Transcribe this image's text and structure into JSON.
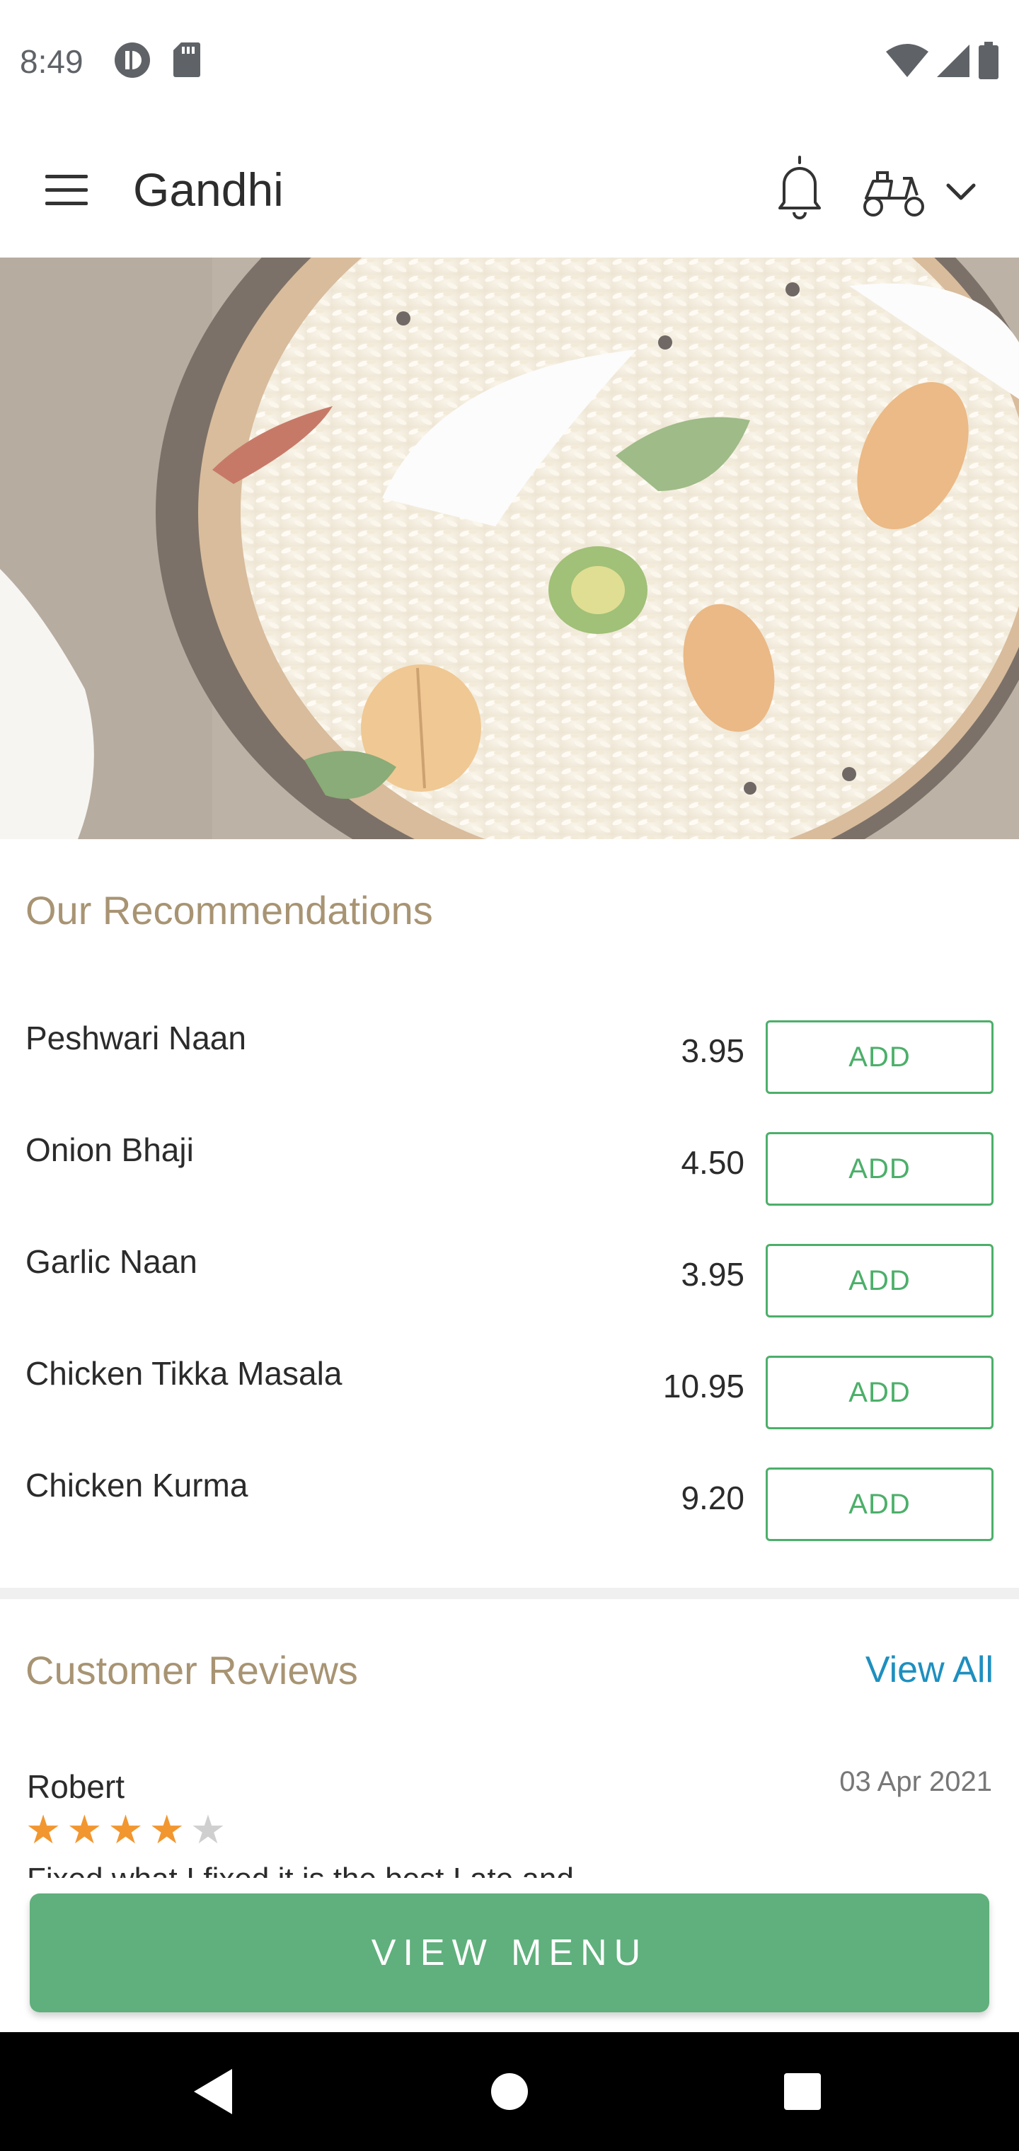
{
  "status_bar": {
    "time": "8:49",
    "icons": [
      "data-saver-icon",
      "sd-card-icon",
      "wifi-icon",
      "signal-icon",
      "battery-icon"
    ]
  },
  "app_bar": {
    "title": "Gandhi",
    "icons": [
      "menu-icon",
      "bell-icon",
      "delivery-scooter-icon",
      "chevron-down-icon"
    ]
  },
  "recommendations": {
    "title": "Our Recommendations",
    "items": [
      {
        "name": "Peshwari Naan",
        "price": "3.95",
        "button": "ADD"
      },
      {
        "name": "Onion Bhaji",
        "price": "4.50",
        "button": "ADD"
      },
      {
        "name": "Garlic Naan",
        "price": "3.95",
        "button": "ADD"
      },
      {
        "name": "Chicken Tikka Masala",
        "price": "10.95",
        "button": "ADD"
      },
      {
        "name": "Chicken Kurma",
        "price": "9.20",
        "button": "ADD"
      }
    ]
  },
  "reviews": {
    "title": "Customer Reviews",
    "view_all": "View All",
    "items": [
      {
        "author": "Robert",
        "date": "03 Apr 2021",
        "rating": 4,
        "max_rating": 5,
        "text": "Fixed what I fixed it is the best I ate and"
      }
    ]
  },
  "cta": {
    "label": "VIEW MENU"
  },
  "colors": {
    "accent_green": "#5fb07c",
    "add_green": "#4caf6a",
    "section_title": "#a89473",
    "link_blue": "#1e8fbf",
    "star_on": "#f2962f",
    "star_off": "#cfcfcf"
  },
  "nav_bar": {
    "icons": [
      "back-icon",
      "home-icon",
      "recents-icon"
    ]
  }
}
